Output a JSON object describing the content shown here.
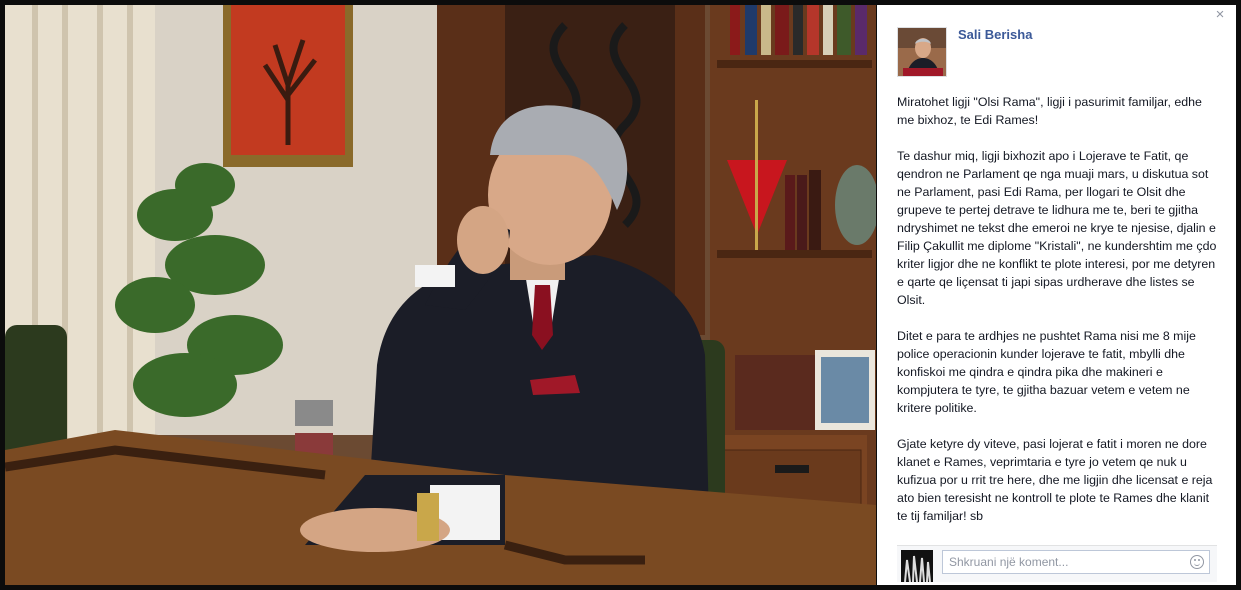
{
  "viewer": {
    "close_label": "×"
  },
  "post": {
    "author": "Sali Berisha",
    "paragraphs": [
      "Miratohet ligji \"Olsi Rama\", ligji i pasurimit familjar, edhe me bixhoz, te Edi Rames!",
      "Te dashur miq, ligji bixhozit apo i Lojerave te Fatit, qe qendron ne Parlament qe nga muaji mars, u diskutua sot ne Parlament, pasi Edi Rama, per llogari te Olsit dhe grupeve te pertej detrave te lidhura me te, beri te gjitha ndryshimet ne tekst dhe emeroi ne krye te njesise, djalin e Filip Çakullit me diplome \"Kristali\", ne kundershtim me çdo kriter ligjor dhe ne konflikt te plote interesi, por me detyren e qarte qe liçensat ti japi sipas urdherave dhe listes se Olsit.",
      "Ditet e para te ardhjes ne pushtet Rama nisi me 8 mije police operacionin kunder lojerave te fatit, mbylli dhe konfiskoi me qindra e qindra pika dhe makineri e kompjutera te tyre, te gjitha bazuar vetem e vetem ne kritere politike.",
      "Gjate ketyre dy viteve, pasi lojerat e fatit i moren ne dore klanet e Rames, veprimtaria e tyre jo vetem qe nuk u kufizua por u rrit tre here, dhe me ligjin dhe licensat e reja ato bien teresisht ne kontroll te plote te Rames dhe klanit te tij familjar! sb"
    ]
  },
  "comment": {
    "placeholder": "Shkruani një koment..."
  },
  "icons": {
    "close": "close-icon",
    "emoji": "emoji-icon"
  },
  "colors": {
    "author_link": "#3b5998",
    "text": "#141823",
    "backdrop": "#0c0c0c"
  }
}
